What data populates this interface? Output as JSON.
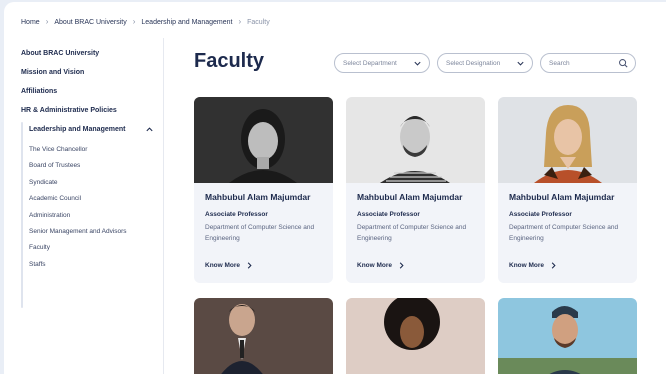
{
  "breadcrumb": {
    "items": [
      "Home",
      "About BRAC University",
      "Leadership and Management",
      "Faculty"
    ]
  },
  "sidebar": {
    "items": [
      "About BRAC University",
      "Mission and Vision",
      "Affiliations",
      "HR & Administrative Policies"
    ],
    "expanded": {
      "label": "Leadership and Management",
      "children": [
        "The Vice Chancellor",
        "Board of Trustees",
        "Syndicate",
        "Academic Council",
        "Administration",
        "Senior Management and Advisors",
        "Faculty",
        "Staffs"
      ]
    }
  },
  "main": {
    "title": "Faculty",
    "filters": {
      "department_placeholder": "Select Department",
      "designation_placeholder": "Select Designation",
      "search_placeholder": "Search"
    }
  },
  "cards": [
    {
      "name": "Mahbubul Alam Majumdar",
      "role": "Associate Professor",
      "dept": "Department of Computer Science and Engineering",
      "link": "Know More"
    },
    {
      "name": "Mahbubul Alam Majumdar",
      "role": "Associate Professor",
      "dept": "Department of Computer Science and Engineering",
      "link": "Know More"
    },
    {
      "name": "Mahbubul Alam Majumdar",
      "role": "Associate Professor",
      "dept": "Department of Computer Science and Engineering",
      "link": "Know More"
    }
  ],
  "colors": {
    "primary_text": "#1d2a4d",
    "card_bg": "#f2f4f9",
    "page_bg": "#e9eef6"
  }
}
